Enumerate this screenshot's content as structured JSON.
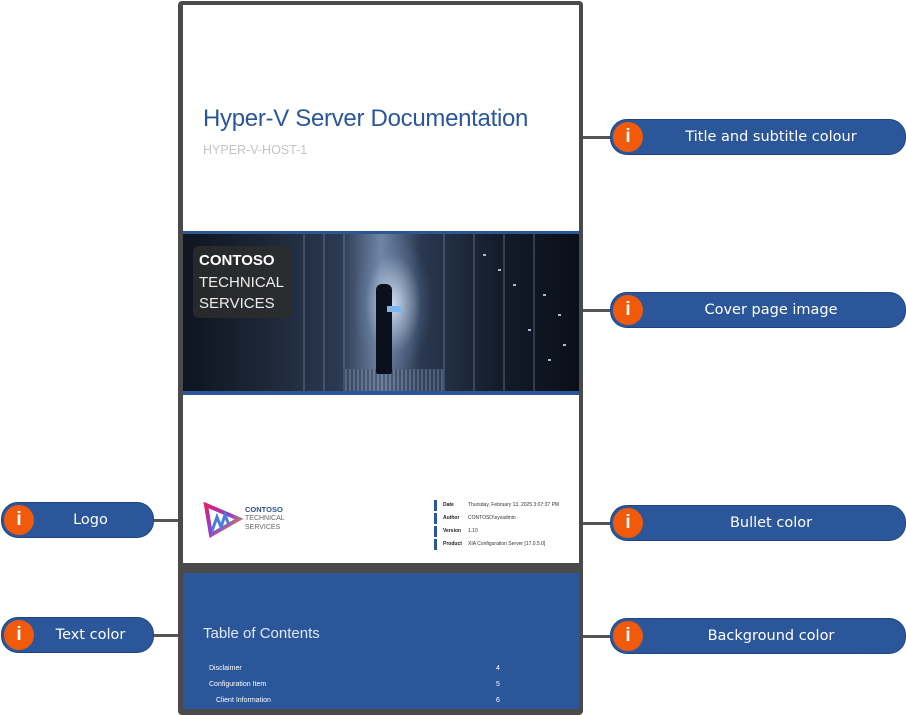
{
  "document": {
    "title": "Hyper-V Server Documentation",
    "subtitle": "HYPER-V-HOST-1",
    "cover_image": {
      "description": "Technician with laptop in a server room aisle",
      "overlay_lines": [
        "CONTOSO",
        "TECHNICAL",
        "SERVICES"
      ]
    },
    "logo": {
      "lines": [
        "CONTOSO",
        "TECHNICAL",
        "SERVICES"
      ]
    },
    "metadata": [
      {
        "key": "Date",
        "value": "Thursday, February 13, 2025 3:07:37 PM"
      },
      {
        "key": "Author",
        "value": "CONTOSO\\sysadmin"
      },
      {
        "key": "Version",
        "value": "1.10"
      },
      {
        "key": "Product",
        "value": "XIA Configuration Server [17.0.5.0]"
      }
    ],
    "toc": {
      "title": "Table of Contents",
      "entries": [
        {
          "label": "Disclaimer",
          "page": "4"
        },
        {
          "label": "Configuration Item",
          "page": "5"
        },
        {
          "label": "Client Information",
          "page": "6"
        }
      ]
    }
  },
  "callouts": [
    {
      "label": "Title and subtitle colour",
      "icon": "info-icon"
    },
    {
      "label": "Cover page image",
      "icon": "info-icon"
    },
    {
      "label": "Logo",
      "icon": "info-icon"
    },
    {
      "label": "Bullet color",
      "icon": "info-icon"
    },
    {
      "label": "Text color",
      "icon": "info-icon"
    },
    {
      "label": "Background color",
      "icon": "info-icon"
    }
  ],
  "colors": {
    "brand_blue": "#2b579a",
    "subtitle_gray": "#c4c4c4",
    "callout_icon": "#f05a0a",
    "frame": "#4a4a4a"
  }
}
